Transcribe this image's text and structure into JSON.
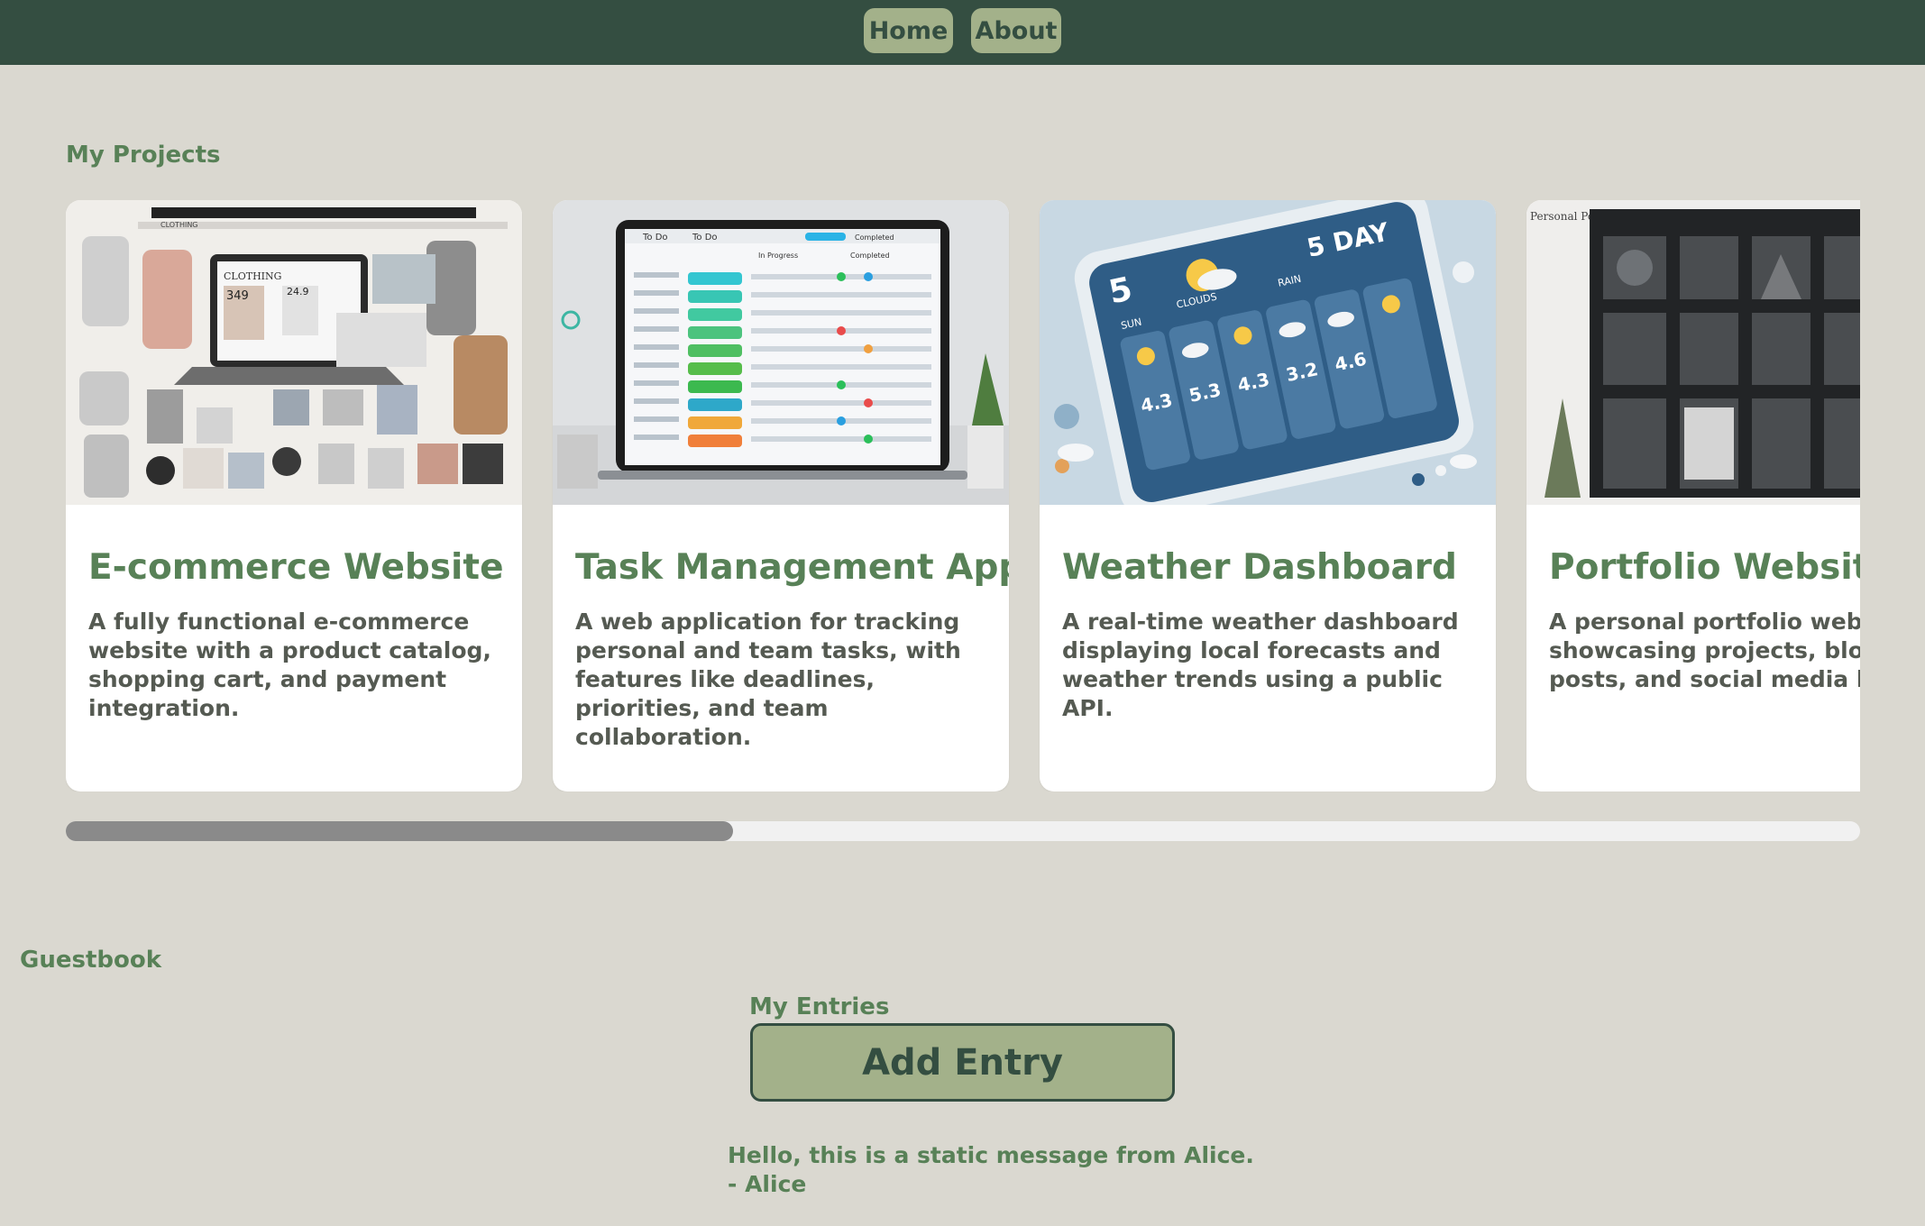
{
  "nav": {
    "home_label": "Home",
    "about_label": "About"
  },
  "projects": {
    "title": "My Projects",
    "cards": [
      {
        "title": "E-commerce Website",
        "description": "A fully functional e-commerce website with a product catalog, shopping cart, and payment integration.",
        "image": "ecommerce-collage-image",
        "image_text": [
          "CLOTHING",
          "349",
          "24.9"
        ]
      },
      {
        "title": "Task Management App",
        "description": "A web application for tracking personal and team tasks, with features like deadlines, priorities, and team collaboration.",
        "image": "laptop-task-board-image",
        "image_text": [
          "To Do",
          "In Progress",
          "Completed"
        ]
      },
      {
        "title": "Weather Dashboard",
        "description": "A real-time weather dashboard displaying local forecasts and weather trends using a public API.",
        "image": "weather-tablet-image",
        "image_text": [
          "5 DAY",
          "5",
          "SUN",
          "CLOUDS",
          "RAIN",
          "4.3",
          "5.3",
          "4.3",
          "3.2",
          "4.6"
        ]
      },
      {
        "title": "Portfolio Website",
        "description": "A personal portfolio website showcasing projects, blog posts, and social media links.",
        "image": "portfolio-grid-image",
        "image_text": [
          "Personal Portfolio"
        ]
      }
    ],
    "scroll_position": 0.0
  },
  "guestbook": {
    "title": "Guestbook",
    "entries_label": "My Entries",
    "add_entry_label": "Add Entry",
    "message": "Hello, this is a static message from Alice.",
    "author": "- Alice"
  },
  "colors": {
    "page_bg": "#dad8d0",
    "header_bg": "#344e41",
    "accent": "#588157",
    "button_bg": "#a3b18a",
    "card_bg": "#ffffff"
  }
}
